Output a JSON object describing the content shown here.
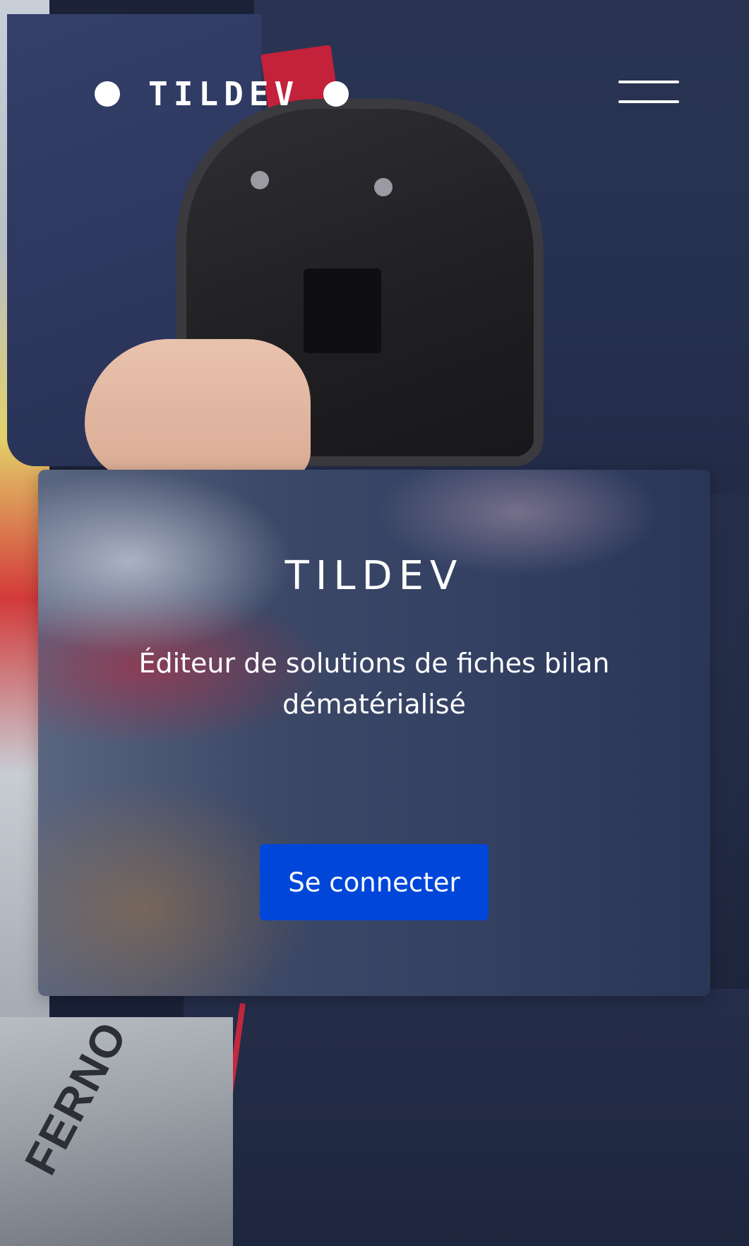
{
  "header": {
    "logo_text": "TILDEV",
    "menu_icon": "hamburger-menu-icon"
  },
  "hero": {
    "title": "TILDEV",
    "subtitle": "Éditeur de solutions de fiches bilan dématérialisé",
    "login_button_label": "Se connecter"
  },
  "background": {
    "ferno_label": "FERNO"
  },
  "colors": {
    "button_bg": "#0047d9",
    "text": "#ffffff",
    "uniform_navy": "#2a3452",
    "accent_red": "#c4213a"
  }
}
